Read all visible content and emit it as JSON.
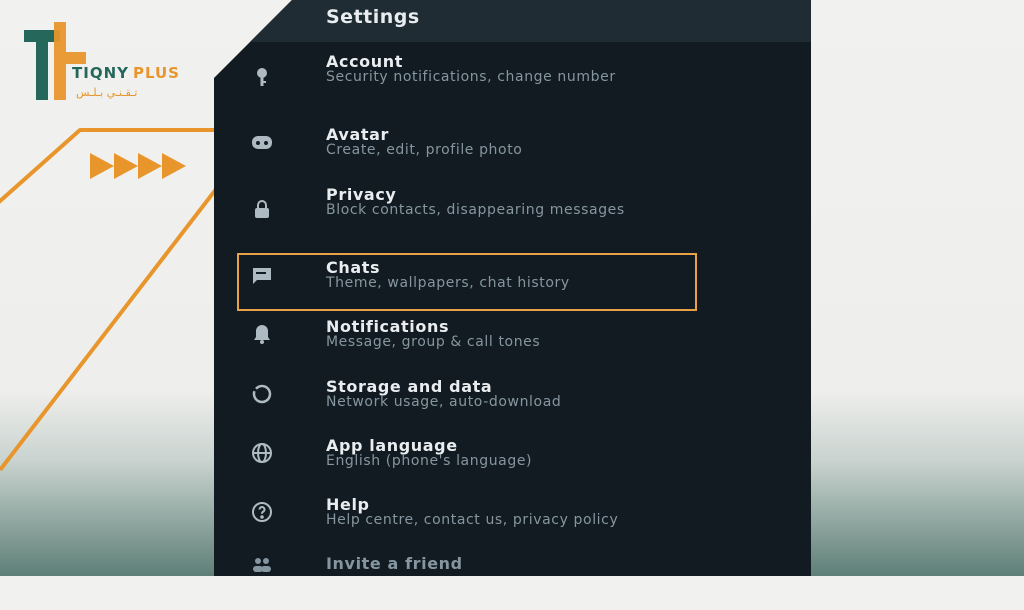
{
  "brand": {
    "name": "TIQNY",
    "plus": "PLUS",
    "arabic": "تـقـنـي بـلـس"
  },
  "settings": {
    "title": "Settings",
    "items": [
      {
        "title": "Account",
        "subtitle": "Security notifications, change number",
        "icon": "key-icon"
      },
      {
        "title": "Avatar",
        "subtitle": "Create, edit, profile photo",
        "icon": "avatar-icon"
      },
      {
        "title": "Privacy",
        "subtitle": "Block contacts, disappearing messages",
        "icon": "lock-icon"
      },
      {
        "title": "Chats",
        "subtitle": "Theme, wallpapers, chat history",
        "icon": "chat-icon"
      },
      {
        "title": "Notifications",
        "subtitle": "Message, group & call tones",
        "icon": "bell-icon"
      },
      {
        "title": "Storage and data",
        "subtitle": "Network usage, auto-download",
        "icon": "storage-icon"
      },
      {
        "title": "App language",
        "subtitle": "English (phone's language)",
        "icon": "globe-icon"
      },
      {
        "title": "Help",
        "subtitle": "Help centre, contact us, privacy policy",
        "icon": "help-icon"
      },
      {
        "title": "Invite a friend",
        "subtitle": "",
        "icon": "people-icon"
      }
    ]
  },
  "colors": {
    "accent": "#e8962c",
    "brand_green": "#26675c",
    "panel": "#111b21"
  }
}
